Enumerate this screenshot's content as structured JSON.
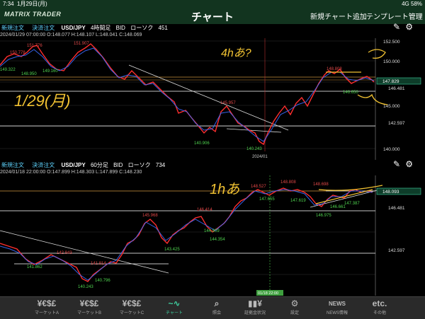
{
  "status": {
    "time": "7:34",
    "date": "1月29日(月)",
    "signal": "4G 58%"
  },
  "header": {
    "logo": "MATRIX TRADER",
    "title": "チャート",
    "add_chart": "新規チャート追加",
    "template": "テンプレート管理"
  },
  "charts": [
    {
      "buy_label": "新規注文",
      "sell_label": "決済注文",
      "symbol": "USD/JPY",
      "timeframe": "4時間足",
      "side": "BID",
      "style": "ローソク",
      "count": "451",
      "ohlc": "2024/01/29 07:00:00   O:148.077  H:148.107  L:148.041  C:148.069",
      "price_ticks": [
        "152.500",
        "150.000",
        "147.500",
        "145.000",
        "142.500",
        "140.000"
      ],
      "level_labels": [
        "146.481",
        "142.597"
      ],
      "current_price": "147.829",
      "annotations": [
        "151.776",
        "151.907",
        "150.778",
        "149.322",
        "148.950",
        "149.160",
        "145.957",
        "140.906",
        "140.243",
        "148.808",
        "146.650"
      ],
      "date_label": "2024/01",
      "handwriting": [
        "4hあ?",
        "1/29(月)"
      ]
    },
    {
      "buy_label": "新規注文",
      "sell_label": "決済注文",
      "symbol": "USD/JPY",
      "timeframe": "60分足",
      "side": "BID",
      "style": "ローソク",
      "count": "734",
      "ohlc": "2024/01/18 22:00:00   O:147.899  H:148.303  L:147.899  C:148.230",
      "price_ticks": [
        "148.093",
        "146.481",
        "142.597"
      ],
      "current_price": "148.093",
      "annotations": [
        "142.843",
        "141.862",
        "141.814",
        "140.796",
        "140.243",
        "145.968",
        "143.425",
        "146.414",
        "144.909",
        "144.354",
        "148.527",
        "147.655",
        "148.808",
        "148.698",
        "147.619",
        "146.975",
        "147.387",
        "146.661"
      ],
      "date_label": "01/18 22:00",
      "handwriting": [
        "1hあ"
      ]
    }
  ],
  "footer": {
    "items": [
      {
        "label": "マーケットA",
        "icon": "¥€$£"
      },
      {
        "label": "マーケットB",
        "icon": "¥€$£"
      },
      {
        "label": "マーケットC",
        "icon": "¥€$£"
      },
      {
        "label": "チャート",
        "icon": "~∿"
      },
      {
        "label": "照会",
        "icon": "⌕"
      },
      {
        "label": "証拠金状況",
        "icon": "▮▮¥"
      },
      {
        "label": "設定",
        "icon": "⚙"
      },
      {
        "label": "NEWS情報",
        "icon": "NEWS"
      },
      {
        "label": "その他",
        "icon": "etc."
      }
    ]
  },
  "colors": {
    "header_bg": "#12341f",
    "up_candle": "#ff2e2e",
    "down_candle": "#3a6cff",
    "accent": "#3fd0a0",
    "annotation_handwriting": "#f1c232",
    "level_line": "#ffffff"
  }
}
